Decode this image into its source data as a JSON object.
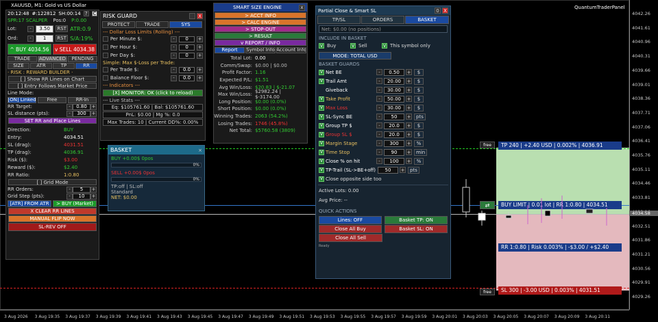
{
  "chart": {
    "symbol": "XAUUSD, M1: Gold vs US Dollar",
    "brand": "QuantumTraderPanel",
    "prices": [
      "4042.26",
      "4041.61",
      "4040.96",
      "4040.31",
      "4039.66",
      "4039.01",
      "4038.36",
      "4037.71",
      "4037.06",
      "4036.41",
      "4035.76",
      "4035.11",
      "4034.46",
      "4033.81",
      "4033.16",
      "4032.51",
      "4031.86",
      "4031.21",
      "4030.56",
      "4029.91",
      "4029.26"
    ],
    "price_tags": [
      "4034.58"
    ],
    "times": [
      "3 Aug 2026",
      "3 Aug 19:35",
      "3 Aug 19:37",
      "3 Aug 19:39",
      "3 Aug 19:41",
      "3 Aug 19:43",
      "3 Aug 19:45",
      "3 Aug 19:47",
      "3 Aug 19:49",
      "3 Aug 19:51",
      "3 Aug 19:53",
      "3 Aug 19:55",
      "3 Aug 19:57",
      "3 Aug 19:59",
      "3 Aug 20:01",
      "3 Aug 20:03",
      "3 Aug 20:05",
      "3 Aug 20:07",
      "3 Aug 20:09",
      "3 Aug 20:11"
    ],
    "tp_label": "TP 240 | +2.40 USD | 0.002% | 4036.91",
    "buylimit_label": "BUY LIMIT | 0.01 lot | RR 1:0.80 | 4034.51",
    "rr_label": "RR 1:0.80 | Risk 0.003% | -$3.00 / +$2.40",
    "sl_label": "SL 300 | -3.00 USD | 0.003% | 4031.51",
    "free": "free"
  },
  "left": {
    "time": "20:12:48",
    "id": "#:122812",
    "sh": "SH:00:14",
    "q": "?",
    "c": "C",
    "spr": "SPR:17 SCALPER",
    "pos": "Pos:0",
    "pnl": "P:0.00",
    "lot_label": "Lot:",
    "lot": "3.50",
    "rst": "RST",
    "atr": "ATR:0.9",
    "ord_label": "Ord:",
    "ord": "1",
    "sa": "S/A:19%",
    "buy": "^ BUY  4034.56",
    "sell": "v SELL  4034.38",
    "tabs1": [
      "TRADE",
      "ADVANCED",
      "PENDING"
    ],
    "tabs2": [
      "SIZE",
      "ATR",
      "TP",
      "RR"
    ],
    "rr_title": "· RISK : REWARD BUILDER ·",
    "show_rr": "[ ] Show RR Lines on Chart",
    "entry_follows": "[ ] Entry Follows Market Price",
    "line_mode": "Line Mode:",
    "modes": [
      "[ON] Linked",
      "Free",
      "RR-In"
    ],
    "rr_target_l": "RR Target:",
    "rr_target": "0.80",
    "sl_dist_l": "SL distance (pts):",
    "sl_dist": "300",
    "set_rr": "SET RR and Place Lines",
    "stats": [
      [
        "Direction:",
        "BUY"
      ],
      [
        "Entry:",
        "4034.51"
      ],
      [
        "SL (drag):",
        "4031.51"
      ],
      [
        "TP (drag):",
        "4036.91"
      ],
      [
        "Risk ($):",
        "$3.00"
      ],
      [
        "Reward ($):",
        "$2.40"
      ],
      [
        "RR Ratio:",
        "1:0.80"
      ]
    ],
    "grid_mode": "[ ] Grid Mode",
    "rr_orders_l": "RR Orders:",
    "rr_orders": "5",
    "grid_step_l": "Grid Step (pts):",
    "grid_step": "10",
    "atr_from": "[ATR] FROM ATR",
    "buy_market": "> BUY (Market)",
    "clear_rr": "X CLEAR RR LINES",
    "manual_flip": "MANUAL FLIP NOW",
    "slrev": "SL-REV OFF"
  },
  "risk": {
    "title": "RISK GUARD",
    "tabs": [
      "PROTECT",
      "TRADE",
      "SYS"
    ],
    "limits_title": "--- Dollar Loss Limits (Rolling) ---",
    "rows": [
      [
        "Per Minute $:",
        "0"
      ],
      [
        "Per Hour $:",
        "0"
      ],
      [
        "Per Day $:",
        "0"
      ]
    ],
    "simple": "Simple: Max $-Loss per Trade:",
    "rows2": [
      [
        "Per Trade $:",
        "0.0"
      ],
      [
        "Balance Floor $:",
        "0.0"
      ]
    ],
    "indicators": "--- Indicators ---",
    "monitor": "[X] MONITOR: OK (click to reload)",
    "live": "--- Live Stats ---",
    "eq": "Eq: $105761.60 | Bal: $105761.60",
    "pnl": "PnL: $0.00 | Mg %: 0.0",
    "max": "Max Trades: 10 | Current DD%: 0.00%"
  },
  "basket": {
    "title": "BASKET",
    "buy": "BUY  +0.00$  0pos",
    "sell": "SELL  +0.00$  0pos",
    "pct": "0%",
    "tp": "TP:off | SL:off",
    "std": "Standard",
    "net": "NET: $0.00"
  },
  "smart": {
    "title": "SMART SIZE ENGINE",
    "menu": [
      "> ACCT INFO",
      "> CALC ENGINE",
      "> STOP-OUT",
      "> RESULT",
      "v REPORT / INFO"
    ],
    "tabs": [
      "Report",
      "Symbol Info",
      "Account Info"
    ],
    "rows": [
      [
        "Total Lot:",
        "0.00"
      ],
      [
        "Comm/Swap:",
        "$0.00 | $0.00"
      ],
      [
        "Profit Factor:",
        "1.16"
      ],
      [
        "Expected P/L:",
        "$1.51"
      ],
      [
        "Avg Win/Loss:",
        "$20.83 | $-21.07"
      ],
      [
        "Max Win/Loss:",
        "$2982.24 | $-3174.00"
      ],
      [
        "Long Position:",
        "$0.00 (0.0%)"
      ],
      [
        "Short Position:",
        "$0.00 (0.0%)"
      ],
      [
        "Winning Trades:",
        "2063 (54.2%)"
      ],
      [
        "Losing Trades:",
        "1746 (45.8%)"
      ],
      [
        "Net Total:",
        "$5760.58 (3809)"
      ]
    ]
  },
  "partial": {
    "title": "Partial Close & Smart SL",
    "tabs": [
      "TP/SL",
      "ORDERS",
      "BASKET"
    ],
    "net": "Net: $0.00  (no positions)",
    "include": "INCLUDE IN BASKET",
    "inc": [
      "Buy",
      "Sell",
      "This symbol only"
    ],
    "mode": "MODE: TOTAL USD",
    "guards": "BASKET GUARDS",
    "grows": [
      [
        "Net BE",
        "0.50",
        "$"
      ],
      [
        "Trail Amt",
        "20.00",
        "$"
      ],
      [
        "Giveback",
        "30.00",
        "$"
      ],
      [
        "Take Profit",
        "50.00",
        "$"
      ],
      [
        "Max Loss",
        "30.00",
        "$"
      ],
      [
        "SL-Sync BE",
        "50",
        "pts"
      ],
      [
        "Group TP $",
        "20.0",
        "$"
      ],
      [
        "Group SL $",
        "20.0",
        "$"
      ],
      [
        "Margin Stage",
        "300",
        "%"
      ],
      [
        "Time Stop",
        "90",
        "min"
      ],
      [
        "Close % on hit",
        "100",
        "%"
      ],
      [
        "TP-Trail (SL->BE+off)",
        "50",
        "pts"
      ]
    ],
    "close_opp": "Close opposite side too",
    "active": "Active Lots: 0.00",
    "avg": "Avg Price: --",
    "quick": "QUICK ACTIONS",
    "qa": [
      "Lines: OFF",
      "Basket TP: ON",
      "Close All Buy",
      "Basket SL: ON",
      "Close All Sell"
    ],
    "ready": "Ready"
  }
}
